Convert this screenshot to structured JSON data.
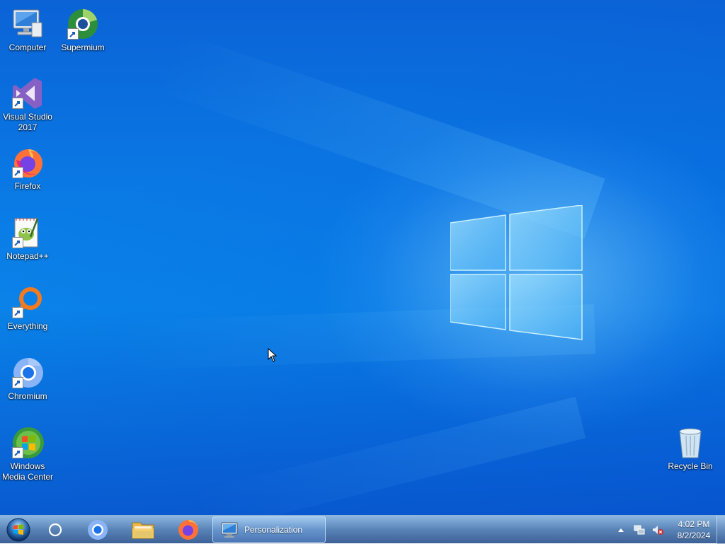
{
  "desktop": {
    "icons": [
      {
        "label": "Computer",
        "icon": "computer-icon",
        "shortcut": false
      },
      {
        "label": "Supermium",
        "icon": "supermium-icon",
        "shortcut": true
      },
      {
        "label": "Visual Studio 2017",
        "icon": "visual-studio-icon",
        "shortcut": true
      },
      {
        "label": "Firefox",
        "icon": "firefox-icon",
        "shortcut": true
      },
      {
        "label": "Notepad++",
        "icon": "notepad-plus-plus-icon",
        "shortcut": true
      },
      {
        "label": "Everything",
        "icon": "everything-icon",
        "shortcut": true
      },
      {
        "label": "Chromium",
        "icon": "chromium-icon",
        "shortcut": true
      },
      {
        "label": "Windows Media Center",
        "icon": "windows-media-center-icon",
        "shortcut": true
      },
      {
        "label": "Recycle Bin",
        "icon": "recycle-bin-icon",
        "shortcut": false
      }
    ],
    "wallpaper_colors": {
      "base": "#0a78e4",
      "glow": "#96dcff"
    }
  },
  "taskbar": {
    "start_icon": "windows-start-orb-icon",
    "pinned": [
      {
        "name": "cortana-search",
        "icon": "search-circle-icon"
      },
      {
        "name": "chromium",
        "icon": "chromium-icon"
      },
      {
        "name": "file-explorer",
        "icon": "folder-icon"
      },
      {
        "name": "firefox",
        "icon": "firefox-icon"
      }
    ],
    "active_window": {
      "label": "Personalization",
      "icon": "personalization-icon"
    },
    "tray": {
      "icons": [
        "show-hidden-icons-arrow-icon",
        "network-icon",
        "volume-muted-icon"
      ],
      "time": "4:02 PM",
      "date": "8/2/2024"
    }
  }
}
